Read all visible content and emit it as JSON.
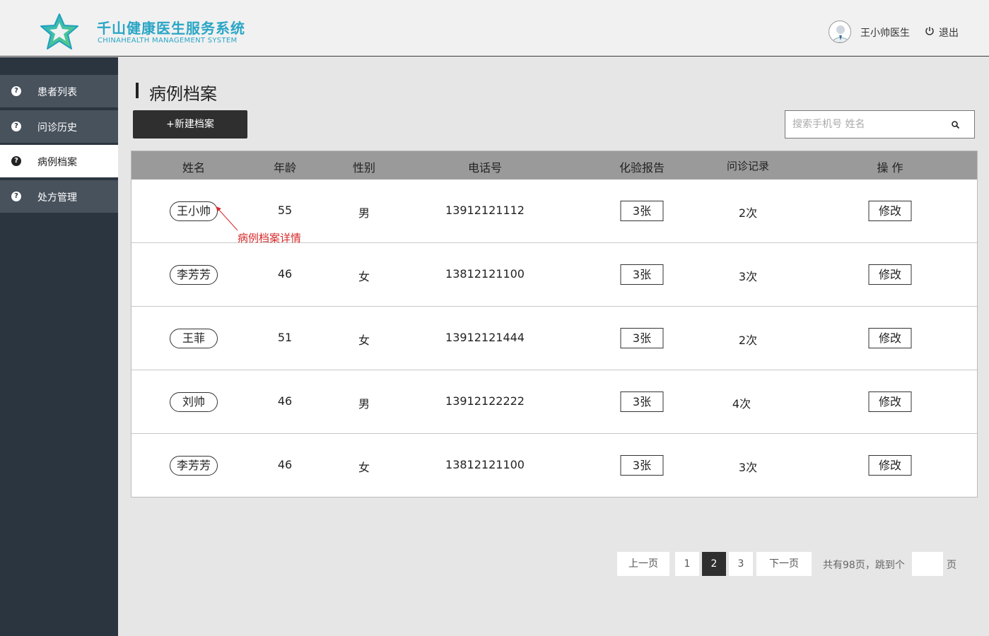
{
  "header": {
    "brand_title": "千山健康医生服务系统",
    "brand_subtitle": "CHINAHEALTH  MANAGEMENT SYSTEM",
    "user_name": "王小帅医生",
    "logout_label": "退出",
    "brand_color": "#2aa6c6"
  },
  "sidebar": {
    "items": [
      {
        "label": "患者列表",
        "icon": "help-circle-icon",
        "active": false
      },
      {
        "label": "问诊历史",
        "icon": "help-circle-icon",
        "active": false
      },
      {
        "label": "病例档案",
        "icon": "help-circle-icon",
        "active": true
      },
      {
        "label": "处方管理",
        "icon": "help-circle-icon",
        "active": false
      }
    ]
  },
  "main": {
    "title": "病例档案",
    "new_button": "+新建档案",
    "search_placeholder": "搜索手机号 姓名"
  },
  "table": {
    "headers": {
      "name": "姓名",
      "age": "年龄",
      "gender": "性别",
      "phone": "电话号",
      "lab": "化验报告",
      "visits": "问诊记录",
      "action": "操  作"
    },
    "rows": [
      {
        "name": "王小帅",
        "age": "55",
        "gender": "男",
        "phone": "13912121112",
        "lab": "3张",
        "visits": "2次",
        "action": "修改"
      },
      {
        "name": "李芳芳",
        "age": "46",
        "gender": "女",
        "phone": "13812121100",
        "lab": "3张",
        "visits": "3次",
        "action": "修改"
      },
      {
        "name": "王菲",
        "age": "51",
        "gender": "女",
        "phone": "13912121444",
        "lab": "3张",
        "visits": "2次",
        "action": "修改"
      },
      {
        "name": "刘帅",
        "age": "46",
        "gender": "男",
        "phone": "13912122222",
        "lab": "3张",
        "visits": "4次",
        "action": "修改"
      },
      {
        "name": "李芳芳",
        "age": "46",
        "gender": "女",
        "phone": "13812121100",
        "lab": "3张",
        "visits": "3次",
        "action": "修改"
      }
    ],
    "annotation": "病例档案详情",
    "annotation_color": "#d62a2a"
  },
  "pagination": {
    "prev": "上一页",
    "pages": [
      "1",
      "2",
      "3"
    ],
    "current": "2",
    "next": "下一页",
    "total_text": "共有98页，跳到个",
    "page_suffix": "页",
    "jump_value": ""
  }
}
